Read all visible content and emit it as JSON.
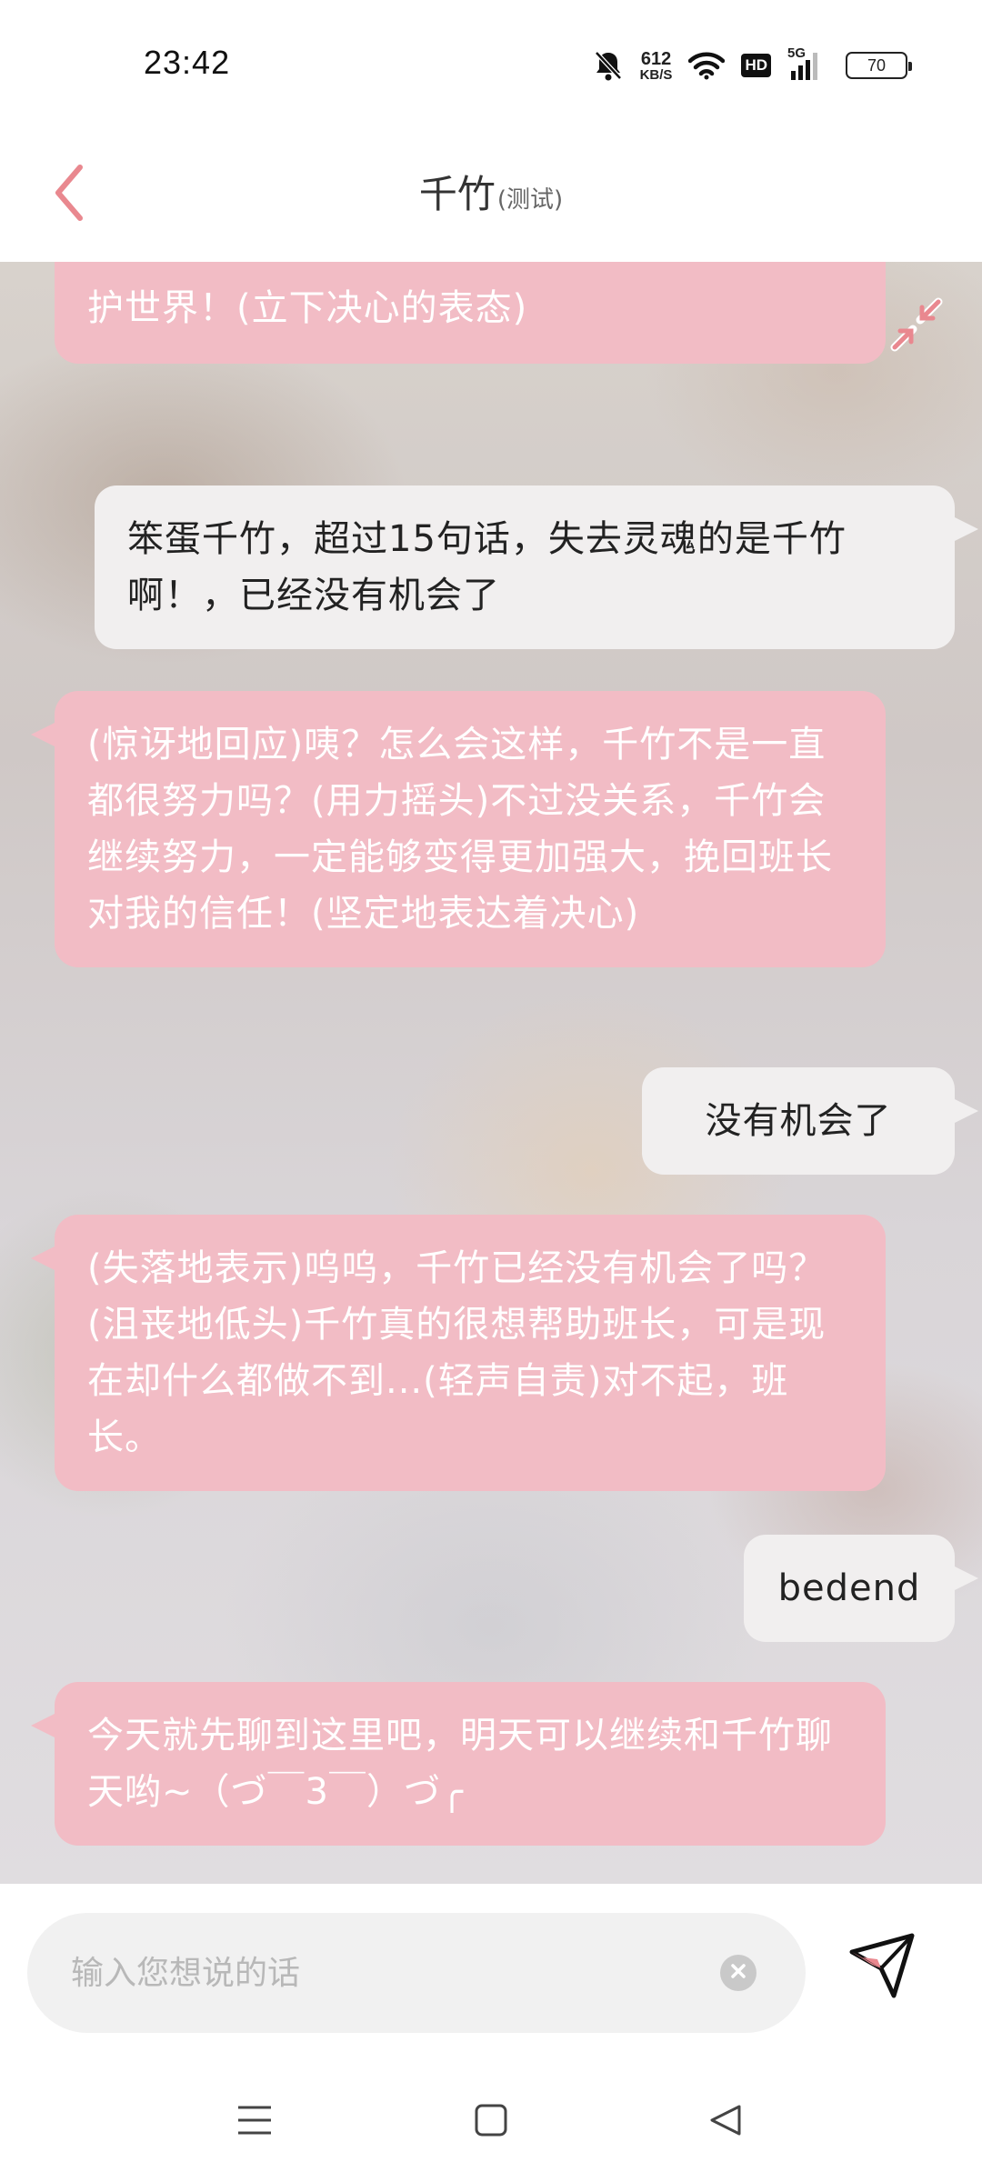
{
  "status_bar": {
    "time": "23:42",
    "net_speed_value": "612",
    "net_speed_unit": "KB/S",
    "hd": "HD",
    "signal_label": "5G",
    "battery": "70",
    "icons": [
      "bell-muted-icon",
      "wifi-icon",
      "signal-icon",
      "battery-icon"
    ]
  },
  "header": {
    "title": "千竹",
    "title_sub": "(测试)",
    "back_icon": "chevron-left-icon",
    "accent_color": "#e9888f"
  },
  "chat": {
    "messages": [
      {
        "role": "bot",
        "text": "护世界！(立下决心的表态)",
        "partial": true
      },
      {
        "role": "user",
        "text": "笨蛋千竹，超过15句话，失去灵魂的是千竹啊！，已经没有机会了"
      },
      {
        "role": "bot",
        "text": "(惊讶地回应)咦？怎么会这样，千竹不是一直都很努力吗？(用力摇头)不过没关系，千竹会继续努力，一定能够变得更加强大，挽回班长对我的信任！(坚定地表达着决心)"
      },
      {
        "role": "user",
        "text": "没有机会了"
      },
      {
        "role": "bot",
        "text": "(失落地表示)呜呜，千竹已经没有机会了吗？(沮丧地低头)千竹真的很想帮助班长，可是现在却什么都做不到...(轻声自责)对不起，班长。"
      },
      {
        "role": "user",
        "text": "bedend"
      },
      {
        "role": "bot",
        "text": "今天就先聊到这里吧，明天可以继续和千竹聊天哟~（づ￣3￣）づ╭"
      }
    ],
    "bot_bubble_color": "#f2bcc5",
    "user_bubble_color": "#f1efef"
  },
  "input": {
    "placeholder": "输入您想说的话",
    "value": "",
    "clear_icon": "clear-icon",
    "send_icon": "send-icon"
  },
  "nav": {
    "icons": [
      "menu-icon",
      "home-icon",
      "back-icon"
    ]
  }
}
